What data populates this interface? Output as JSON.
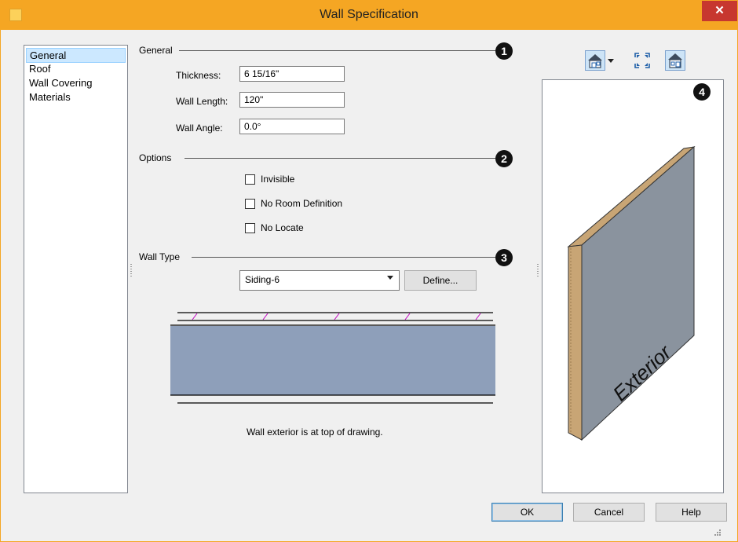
{
  "window": {
    "title": "Wall Specification",
    "close_glyph": "✕"
  },
  "nav": {
    "items": [
      "General",
      "Roof",
      "Wall Covering",
      "Materials"
    ],
    "selected": "General"
  },
  "general": {
    "title": "General",
    "badge": "1",
    "thickness_label": "Thickness:",
    "thickness_value": "6 15/16\"",
    "length_label": "Wall Length:",
    "length_value": "120\"",
    "angle_label": "Wall Angle:",
    "angle_value": "0.0°"
  },
  "options": {
    "title": "Options",
    "badge": "2",
    "invisible_label": "Invisible",
    "invisible_checked": false,
    "no_room_label": "No Room Definition",
    "no_room_checked": false,
    "no_locate_label": "No Locate",
    "no_locate_checked": false
  },
  "wall_type": {
    "title": "Wall Type",
    "badge": "3",
    "selected": "Siding-6",
    "define_label": "Define...",
    "caption": "Wall exterior is at top of drawing."
  },
  "preview": {
    "badge": "4",
    "exterior_label": "Exterior"
  },
  "footer": {
    "ok_label": "OK",
    "cancel_label": "Cancel",
    "help_label": "Help"
  },
  "colors": {
    "accent": "#f5a623",
    "close": "#c7372f",
    "wall_fill": "#8e9fba",
    "wall_face": "#8a939e",
    "wall_edge": "#c8a575"
  },
  "icons": [
    "window-app-icon",
    "close-icon",
    "house-view-icon",
    "dropdown-arrow-icon",
    "fill-window-icon",
    "house-check-icon"
  ]
}
